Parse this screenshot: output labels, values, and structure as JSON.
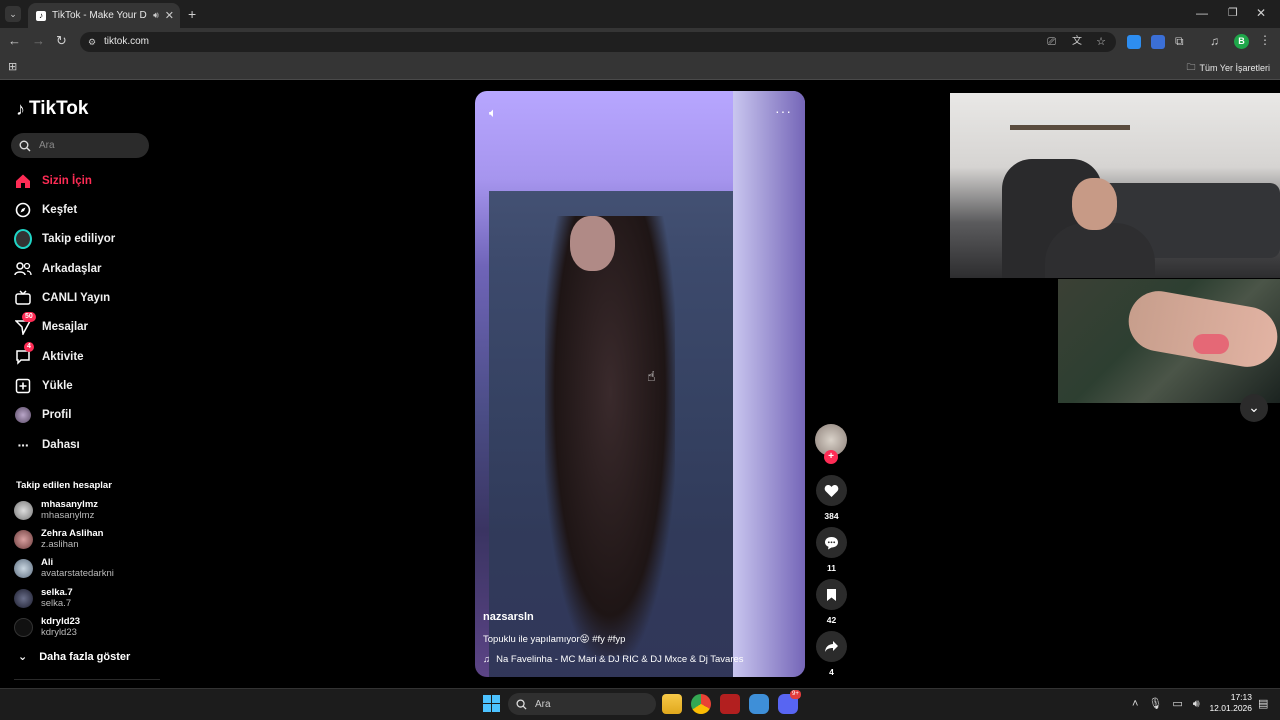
{
  "browser": {
    "tab_title": "TikTok - Make Your Day",
    "url": "tiktok.com",
    "bookmarks_all": "Tüm Yer İşaretleri",
    "profile_initial": "B"
  },
  "sidebar": {
    "logo": "TikTok",
    "search_placeholder": "Ara",
    "nav": [
      {
        "label": "Sizin İçin",
        "icon": "home-icon",
        "active": true
      },
      {
        "label": "Keşfet",
        "icon": "compass-icon"
      },
      {
        "label": "Takip ediliyor",
        "icon": "following-icon"
      },
      {
        "label": "Arkadaşlar",
        "icon": "friends-icon"
      },
      {
        "label": "CANLI Yayın",
        "icon": "live-tv-icon"
      },
      {
        "label": "Mesajlar",
        "icon": "messages-icon",
        "badge": "50"
      },
      {
        "label": "Aktivite",
        "icon": "activity-icon",
        "badge": "4"
      },
      {
        "label": "Yükle",
        "icon": "upload-icon"
      },
      {
        "label": "Profil",
        "icon": "profile-icon"
      },
      {
        "label": "Dahası",
        "icon": "more-dots-icon"
      }
    ],
    "following_title": "Takip edilen hesaplar",
    "accounts": [
      {
        "name": "mhasanylmz",
        "handle": "mhasanylmz"
      },
      {
        "name": "Zehra Aslihan",
        "handle": "z.aslihan"
      },
      {
        "name": "Ali",
        "handle": "avatarstatedarkni"
      },
      {
        "name": "selka.7",
        "handle": "selka.7"
      },
      {
        "name": "kdryld23",
        "handle": "kdryld23"
      }
    ],
    "show_more": "Daha fazla göster"
  },
  "video": {
    "username": "nazsarsln",
    "caption": "Topuklu ile yapılamıyor😝 #fy #fyp",
    "music": "Na Favelinha - MC Mari & DJ RIC & DJ Mxce & Dj Tavares"
  },
  "actions": {
    "likes": "384",
    "comments": "11",
    "saves": "42",
    "shares": "4"
  },
  "taskbar": {
    "search_placeholder": "Ara",
    "time": "17:13",
    "date": "12.01.2026",
    "discord_badge": "9+"
  },
  "colors": {
    "accent": "#fe2c55",
    "background": "#000000"
  }
}
